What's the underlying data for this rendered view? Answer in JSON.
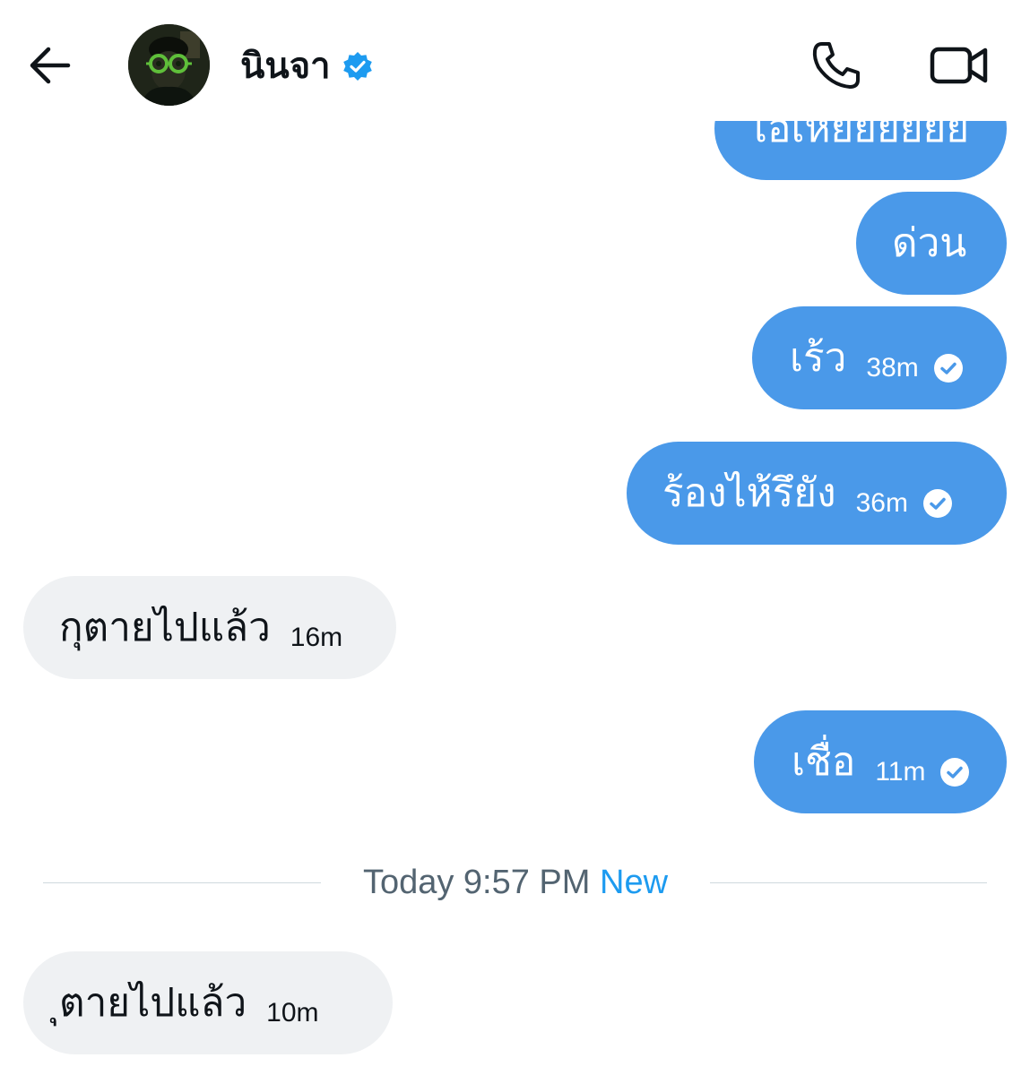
{
  "header": {
    "contact_name": "นินจา",
    "icons": {
      "back": "arrow-left-icon",
      "verified": "verified-badge-icon",
      "call": "phone-icon",
      "video": "video-camera-icon"
    }
  },
  "messages": [
    {
      "direction": "out",
      "text": "เอเหยยยยยย",
      "time": ""
    },
    {
      "direction": "out",
      "text": "ด่วน",
      "time": ""
    },
    {
      "direction": "out",
      "text": "เร้ว",
      "time": "38m",
      "status": "read-check-icon"
    },
    {
      "direction": "out",
      "text": "ร้องไห้รึยัง",
      "time": "36m",
      "status": "read-check-icon"
    },
    {
      "direction": "in",
      "text": "กุตายไปแล้ว",
      "time": "16m"
    },
    {
      "direction": "out",
      "text": "เชื่อ",
      "time": "11m",
      "status": "read-check-icon"
    },
    {
      "direction": "in",
      "text": "ุตายไปแล้ว",
      "time": "10m"
    }
  ],
  "divider": {
    "label": "Today 9:57 PM",
    "new_label": "New"
  },
  "colors": {
    "outgoing_bubble": "#4a99e9",
    "incoming_bubble": "#eff1f3",
    "accent": "#1d9bf0",
    "divider_text": "#536471"
  }
}
